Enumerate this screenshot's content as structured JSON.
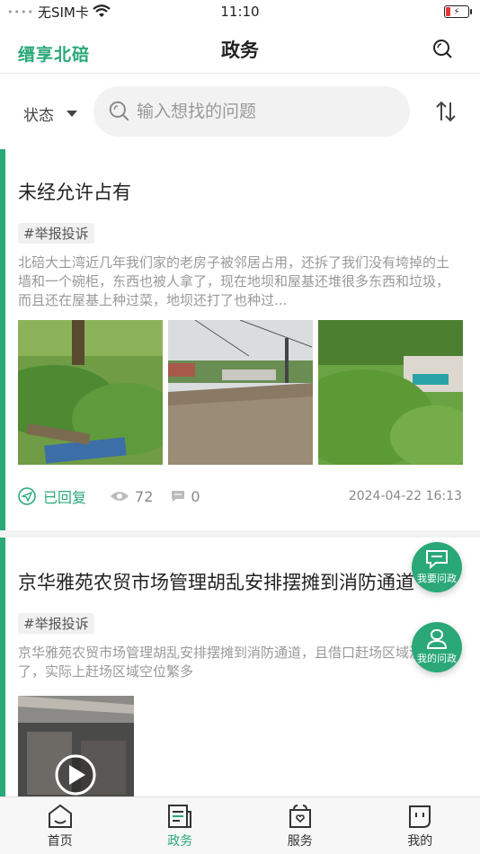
{
  "status_bar": {
    "carrier": "无SIM卡",
    "time": "11:10"
  },
  "nav": {
    "brand": "缙享北碚",
    "title": "政务",
    "search_icon": "search-icon"
  },
  "filter": {
    "status_label": "状态",
    "search_placeholder": "输入想找的问题"
  },
  "posts": [
    {
      "title": "未经允许占有",
      "tag": "#举报投诉",
      "description": "北碚大土湾近几年我们家的老房子被邻居占用，还拆了我们没有垮掉的土墙和一个碗柜，东西也被人拿了，现在地坝和屋基还堆很多东西和垃圾，而且还在屋基上种过菜，地坝还打了也种过...",
      "reply_status": "已回复",
      "views": "72",
      "comments": "0",
      "date": "2024-04-22 16:13"
    },
    {
      "title": "京华雅苑农贸市场管理胡乱安排摆摊到消防通道",
      "tag": "#举报投诉",
      "description": "京华雅苑农贸市场管理胡乱安排摆摊到消防通道，且借口赶场区域没位置了，实际上赶场区域空位繁多"
    }
  ],
  "fab": {
    "ask": "我要问政",
    "mine": "我的问政"
  },
  "tabs": [
    {
      "label": "首页",
      "icon": "home-icon"
    },
    {
      "label": "政务",
      "icon": "document-icon"
    },
    {
      "label": "服务",
      "icon": "service-icon"
    },
    {
      "label": "我的",
      "icon": "profile-icon"
    }
  ],
  "colors": {
    "accent": "#2aa877"
  }
}
